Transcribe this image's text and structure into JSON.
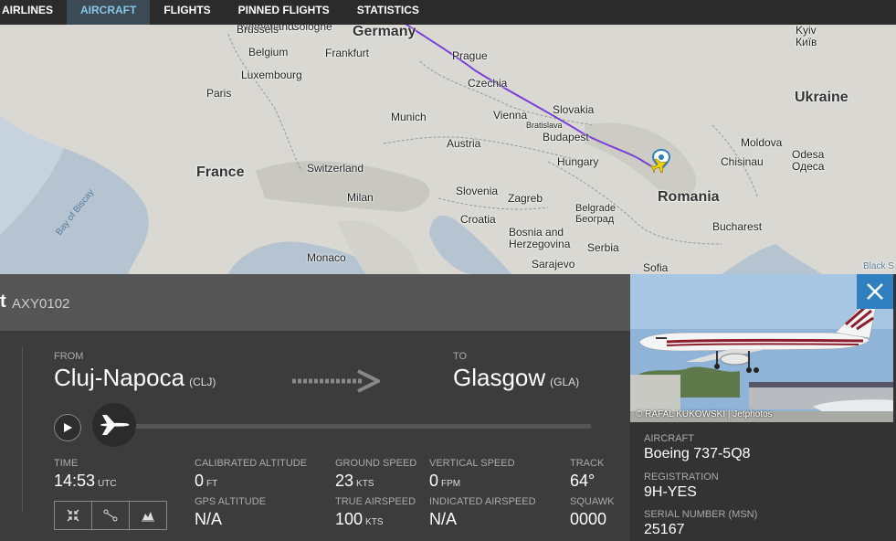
{
  "nav": {
    "tabs": [
      {
        "label": "AIRLINES"
      },
      {
        "label": "AIRCRAFT",
        "active": true
      },
      {
        "label": "FLIGHTS"
      },
      {
        "label": "PINNED FLIGHTS"
      },
      {
        "label": "STATISTICS"
      }
    ]
  },
  "map": {
    "labels": {
      "netherlands": "Netherlands",
      "germany": "Germany",
      "brussels": "Brussels",
      "cologne": "Cologne",
      "belgium": "Belgium",
      "frankfurt": "Frankfurt",
      "prague": "Prague",
      "luxembourg": "Luxembourg",
      "czechia": "Czechia",
      "paris": "Paris",
      "munich": "Munich",
      "vienna": "Vienna",
      "slovakia": "Slovakia",
      "bratislava": "Bratislava",
      "austria": "Austria",
      "budapest": "Budapest",
      "france": "France",
      "switzerland": "Switzerland",
      "hungary": "Hungary",
      "milan": "Milan",
      "slovenia": "Slovenia",
      "zagreb": "Zagreb",
      "croatia": "Croatia",
      "belgrade": "Belgrade\nБеоград",
      "bosnia": "Bosnia and\nHerzegovina",
      "sarajevo": "Sarajevo",
      "serbia": "Serbia",
      "monaco": "Monaco",
      "sofia": "Sofia",
      "romania": "Romania",
      "bucharest": "Bucharest",
      "moldova": "Moldova",
      "chisinau": "Chisinau",
      "odesa": "Odesa\nОдеса",
      "ukraine": "Ukraine",
      "kyiv": "Kyiv\nКиїв",
      "black_sea": "Black S",
      "bay_of_biscay": "Bay of Biscay"
    },
    "route_color": "#7a3fd8",
    "land_color": "#d8d8d4",
    "water_color": "#b6c4d2"
  },
  "flight": {
    "title_fragment": "t",
    "callsign": "AXY0102",
    "from_label": "FROM",
    "from_city": "Cluj-Napoca",
    "from_code": "(CLJ)",
    "to_label": "TO",
    "to_city": "Glasgow",
    "to_code": "(GLA)",
    "progress_fraction": 0.02
  },
  "stats": {
    "time_label": "TIME",
    "time_value": "14:53",
    "time_unit": "UTC",
    "cal_alt_label": "CALIBRATED ALTITUDE",
    "cal_alt_value": "0",
    "cal_alt_unit": "FT",
    "gps_alt_label": "GPS ALTITUDE",
    "gps_alt_value": "N/A",
    "ground_speed_label": "GROUND SPEED",
    "ground_speed_value": "23",
    "ground_speed_unit": "KTS",
    "true_airspeed_label": "TRUE AIRSPEED",
    "true_airspeed_value": "100",
    "true_airspeed_unit": "KTS",
    "vertical_speed_label": "VERTICAL SPEED",
    "vertical_speed_value": "0",
    "vertical_speed_unit": "FPM",
    "indicated_airspeed_label": "INDICATED AIRSPEED",
    "indicated_airspeed_value": "N/A",
    "track_label": "TRACK",
    "track_value": "64°",
    "squawk_label": "SQUAWK",
    "squawk_value": "0000"
  },
  "aircraft": {
    "photo_credit": "© RAFAL KUKOWSKI | Jetphotos",
    "aircraft_label": "AIRCRAFT",
    "aircraft_value": "Boeing 737-5Q8",
    "registration_label": "REGISTRATION",
    "registration_value": "9H-YES",
    "serial_label": "SERIAL NUMBER (MSN)",
    "serial_value": "25167"
  }
}
